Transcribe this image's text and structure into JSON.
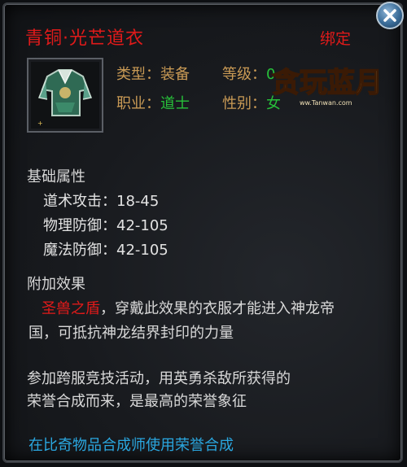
{
  "item": {
    "name": "青铜·光芒道衣",
    "bind_status": "绑定"
  },
  "info": {
    "type_label": "类型：",
    "type_value": "装备",
    "level_label": "等级：",
    "level_value": "0",
    "job_label": "职业：",
    "job_value": "道士",
    "gender_label": "性别：",
    "gender_value": "女"
  },
  "logo": {
    "text": "贪玩蓝月",
    "url": "ww.Tanwan.com"
  },
  "base_attrs": {
    "heading": "基础属性",
    "stats": [
      {
        "label": "道术攻击：",
        "value": "18-45"
      },
      {
        "label": "物理防御：",
        "value": "42-105"
      },
      {
        "label": "魔法防御：",
        "value": "42-105"
      }
    ]
  },
  "extra_effect": {
    "heading": "附加效果",
    "name": "圣兽之盾",
    "line1_rest": "，穿戴此效果的衣服才能进入神龙帝",
    "line2": "国，可抵抗神龙结界封印的力量"
  },
  "description": {
    "line1": "参加跨服竞技活动，用英勇杀敌所获得的",
    "line2": "荣誉合成而来，是最高的荣誉象征"
  },
  "hint": "在比奇物品合成师使用荣誉合成",
  "icons": {
    "close": "close-icon",
    "item": "armor-robe-icon"
  },
  "colors": {
    "title_red": "#e01a1a",
    "attr_gold": "#c99a55",
    "job_green": "#27c03a",
    "hint_blue": "#2aa7e0"
  }
}
